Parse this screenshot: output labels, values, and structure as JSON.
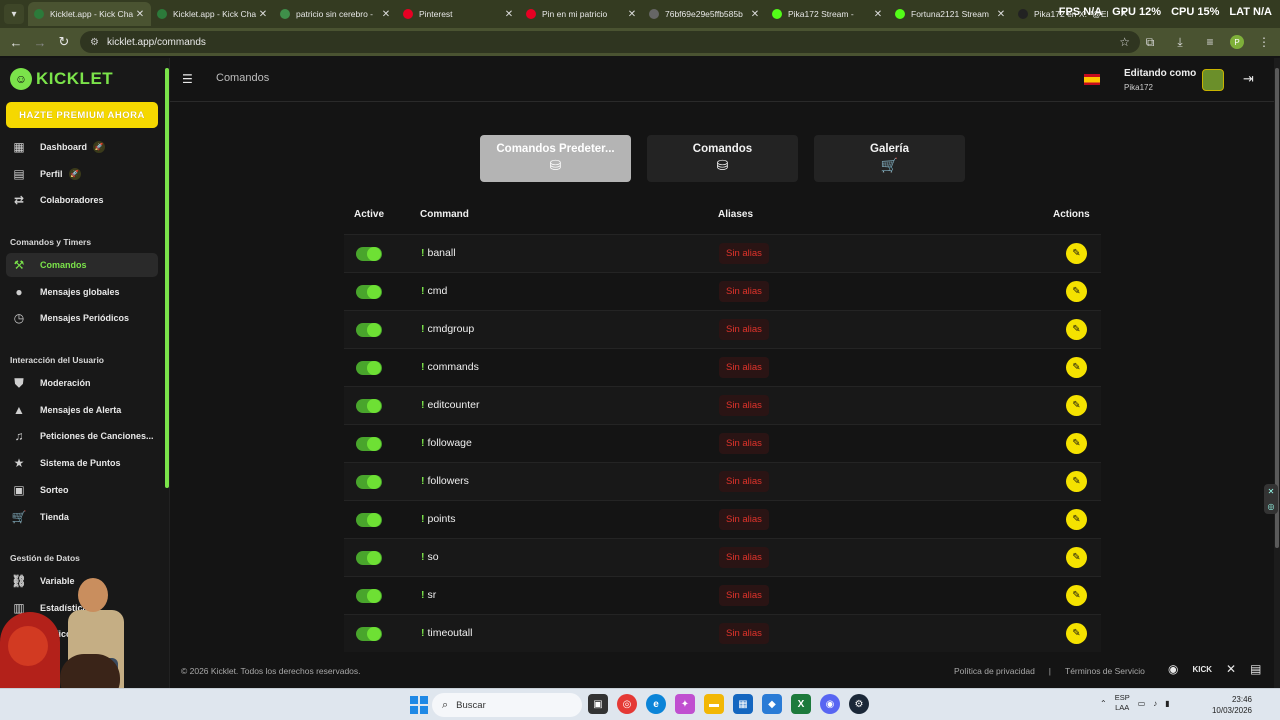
{
  "browser": {
    "tabs": [
      {
        "title": "Kicklet.app - Kick Cha",
        "active": true
      },
      {
        "title": "Kicklet.app - Kick Cha",
        "active": false
      },
      {
        "title": "patricio sin cerebro -",
        "active": false
      },
      {
        "title": "Pinterest",
        "active": false
      },
      {
        "title": "Pin en mi patricio",
        "active": false
      },
      {
        "title": "76bf69e29e5ffb585b",
        "active": false
      },
      {
        "title": "Pika172 Stream -",
        "active": false
      },
      {
        "title": "Fortuna2121 Stream",
        "active": false
      },
      {
        "title": "Pika172 en X: \"@El",
        "active": false
      }
    ],
    "url": "kicklet.app/commands",
    "perf": {
      "fps_label": "FPS",
      "fps_value": "N/A",
      "gpu_label": "GPU",
      "gpu_value": "12%",
      "cpu_label": "CPU",
      "cpu_value": "15%",
      "lat_label": "LAT",
      "lat_value": "N/A"
    },
    "profile_initial": "P"
  },
  "sidebar": {
    "logo_text": "KICKLET",
    "premium_label": "HAZTE PREMIUM AHORA",
    "items_top": [
      {
        "label": "Dashboard",
        "icon": "dashboard-icon",
        "rocket": true
      },
      {
        "label": "Perfil",
        "icon": "profile-icon",
        "rocket": true
      },
      {
        "label": "Colaboradores",
        "icon": "collaborators-icon",
        "rocket": false
      }
    ],
    "section1": "Comandos y Timers",
    "items_cmd": [
      {
        "label": "Comandos",
        "icon": "hammer-icon",
        "active": true
      },
      {
        "label": "Mensajes globales",
        "icon": "chat-icon",
        "active": false
      },
      {
        "label": "Mensajes Periódicos",
        "icon": "clock-icon",
        "active": false
      }
    ],
    "section2": "Interacción del Usuario",
    "items_user": [
      {
        "label": "Moderación",
        "icon": "shield-icon"
      },
      {
        "label": "Mensajes de Alerta",
        "icon": "alert-icon"
      },
      {
        "label": "Peticiones de Canciones...",
        "icon": "music-icon"
      },
      {
        "label": "Sistema de Puntos",
        "icon": "star-icon"
      },
      {
        "label": "Sorteo",
        "icon": "gift-icon"
      },
      {
        "label": "Tienda",
        "icon": "cart-icon"
      }
    ],
    "section3": "Gestión de Datos",
    "items_data": [
      {
        "label": "Variable",
        "icon": "link-icon"
      },
      {
        "label": "Estadísticas",
        "icon": "stats-icon"
      },
      {
        "label": "Gráficos",
        "icon": "chart-icon"
      }
    ]
  },
  "header": {
    "breadcrumb": "Comandos",
    "editing_label": "Editando como",
    "username": "Pika172"
  },
  "tabs": [
    {
      "label": "Comandos Predeter...",
      "icon": "database-check-icon",
      "active": true
    },
    {
      "label": "Comandos",
      "icon": "database-check-icon",
      "active": false
    },
    {
      "label": "Galería",
      "icon": "cart-icon",
      "active": false
    }
  ],
  "table": {
    "headers": {
      "active": "Active",
      "command": "Command",
      "aliases": "Aliases",
      "actions": "Actions"
    },
    "rows": [
      {
        "command": "banall",
        "alias": "Sin alias",
        "active": true
      },
      {
        "command": "cmd",
        "alias": "Sin alias",
        "active": true
      },
      {
        "command": "cmdgroup",
        "alias": "Sin alias",
        "active": true
      },
      {
        "command": "commands",
        "alias": "Sin alias",
        "active": true
      },
      {
        "command": "editcounter",
        "alias": "Sin alias",
        "active": true
      },
      {
        "command": "followage",
        "alias": "Sin alias",
        "active": true
      },
      {
        "command": "followers",
        "alias": "Sin alias",
        "active": true
      },
      {
        "command": "points",
        "alias": "Sin alias",
        "active": true
      },
      {
        "command": "so",
        "alias": "Sin alias",
        "active": true
      },
      {
        "command": "sr",
        "alias": "Sin alias",
        "active": true
      },
      {
        "command": "timeoutall",
        "alias": "Sin alias",
        "active": true
      }
    ]
  },
  "footer": {
    "copyright": "© 2026 Kicklet. Todos los derechos reservados.",
    "privacy": "Política de privacidad",
    "separator": "|",
    "terms": "Términos de Servicio",
    "kick_label": "KICK"
  },
  "taskbar": {
    "search_placeholder": "Buscar",
    "lang_top": "ESP",
    "lang_bottom": "LAA",
    "time": "23:46",
    "date": "10/03/2026"
  },
  "colors": {
    "accent": "#7be34a",
    "premium": "#f5d800",
    "alias_red": "#e0332b",
    "edit_yellow": "#f5e200"
  }
}
